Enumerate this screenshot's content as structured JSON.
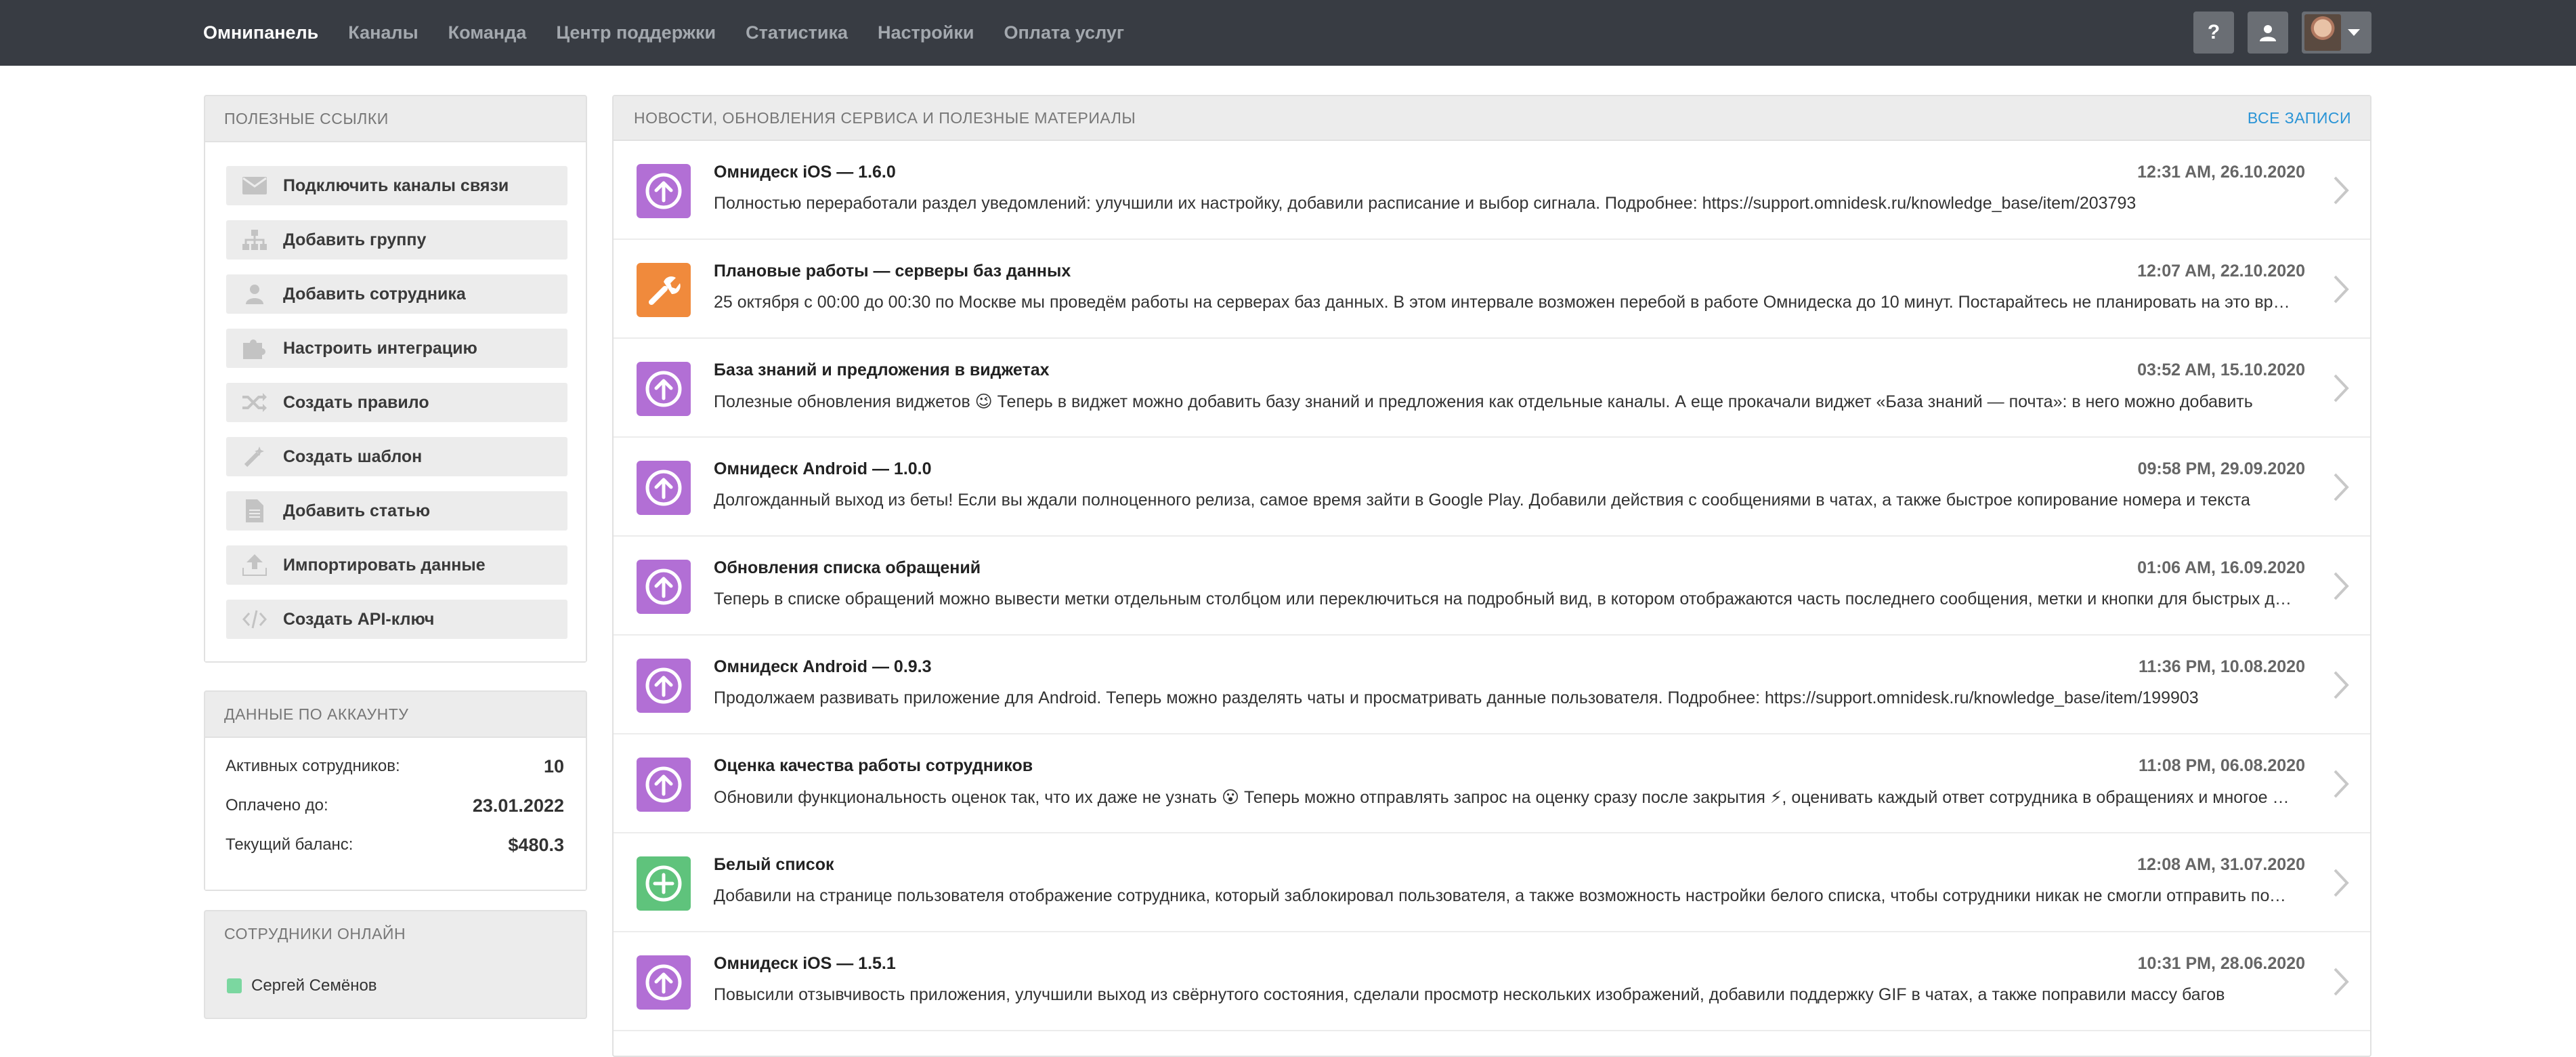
{
  "nav": {
    "items": [
      "Омнипанель",
      "Каналы",
      "Команда",
      "Центр поддержки",
      "Статистика",
      "Настройки",
      "Оплата услуг"
    ],
    "active_index": 0,
    "help_label": "?"
  },
  "links_panel": {
    "title": "ПОЛЕЗНЫЕ ССЫЛКИ",
    "items": [
      {
        "label": "Подключить каналы связи",
        "icon": "envelope-icon"
      },
      {
        "label": "Добавить группу",
        "icon": "sitemap-icon"
      },
      {
        "label": "Добавить сотрудника",
        "icon": "user-icon"
      },
      {
        "label": "Настроить интеграцию",
        "icon": "puzzle-icon"
      },
      {
        "label": "Создать правило",
        "icon": "shuffle-icon"
      },
      {
        "label": "Создать шаблон",
        "icon": "magic-wand-icon"
      },
      {
        "label": "Добавить статью",
        "icon": "document-icon"
      },
      {
        "label": "Импортировать данные",
        "icon": "upload-icon"
      },
      {
        "label": "Создать API-ключ",
        "icon": "code-icon"
      }
    ]
  },
  "account": {
    "title": "ДАННЫЕ ПО АККАУНТУ",
    "rows": [
      {
        "label": "Активных сотрудников:",
        "value": "10"
      },
      {
        "label": "Оплачено до:",
        "value": "23.01.2022"
      },
      {
        "label": "Текущий баланс:",
        "value": "$480.3"
      }
    ]
  },
  "online": {
    "title": "СОТРУДНИКИ ОНЛАЙН",
    "users": [
      {
        "name": "Сергей Семёнов",
        "status_color": "#7bd7a0"
      }
    ]
  },
  "news": {
    "title": "НОВОСТИ, ОБНОВЛЕНИЯ СЕРВИСА И ПОЛЕЗНЫЕ МАТЕРИАЛЫ",
    "all_label": "ВСЕ ЗАПИСИ",
    "items": [
      {
        "title": "Омнидеск iOS — 1.6.0",
        "date": "12:31 AM, 26.10.2020",
        "text": "Полностью переработали раздел уведомлений: улучшили их настройку, добавили расписание и выбор сигнала. Подробнее: https://support.omnidesk.ru/knowledge_base/item/203793",
        "icon": "arrow-up-icon",
        "color": "#b26fd5"
      },
      {
        "title": "Плановые работы — серверы баз данных",
        "date": "12:07 AM, 22.10.2020",
        "text": "25 октября с 00:00 до 00:30 по Москве мы проведём работы на серверах баз данных. В этом интервале возможен перебой в работе Омнидеска до 10 минут. Постарайтесь не планировать на это время важные дела",
        "icon": "wrench-icon",
        "color": "#f08a3c"
      },
      {
        "title": "База знаний и предложения в виджетах",
        "date": "03:52 AM, 15.10.2020",
        "text": "Полезные обновления виджетов 😉 Теперь в виджет можно добавить базу знаний и предложения как отдельные каналы. А еще прокачали виджет «База знаний — почта»:  в него можно добавить",
        "icon": "arrow-up-icon",
        "color": "#b26fd5"
      },
      {
        "title": "Омнидеск Android — 1.0.0",
        "date": "09:58 PM, 29.09.2020",
        "text": "Долгожданный выход из беты! Если вы ждали полноценного релиза, самое время зайти в Google Play. Добавили действия с сообщениями в чатах, а также быстрое копирование номера и текста",
        "icon": "arrow-up-icon",
        "color": "#b26fd5"
      },
      {
        "title": "Обновления списка обращений",
        "date": "01:06 AM, 16.09.2020",
        "text": "Теперь в списке обращений можно вывести метки отдельным столбцом или переключиться на подробный вид, в котором отображаются часть последнего сообщения, метки и кнопки для быстрых действий",
        "icon": "arrow-up-icon",
        "color": "#b26fd5"
      },
      {
        "title": "Омнидеск Android — 0.9.3",
        "date": "11:36 PM, 10.08.2020",
        "text": "Продолжаем развивать приложение для Android. Теперь можно разделять чаты и просматривать данные пользователя. Подробнее: https://support.omnidesk.ru/knowledge_base/item/199903",
        "icon": "arrow-up-icon",
        "color": "#b26fd5"
      },
      {
        "title": "Оценка качества работы сотрудников",
        "date": "11:08 PM, 06.08.2020",
        "text": "Обновили функциональность оценок так, что их даже не узнать 😮 Теперь можно отправлять запрос на оценку сразу после закрытия ⚡, оценивать каждый ответ сотрудника в обращениях и многое другое",
        "icon": "arrow-up-icon",
        "color": "#b26fd5"
      },
      {
        "title": "Белый список",
        "date": "12:08 AM, 31.07.2020",
        "text": "Добавили на странице пользователя отображение сотрудника, который заблокировал пользователя, а также возможность настройки белого списка, чтобы сотрудники никак не смогли отправить пользователя в спам",
        "icon": "plus-icon",
        "color": "#5fc37c"
      },
      {
        "title": "Омнидеск iOS — 1.5.1",
        "date": "10:31 PM, 28.06.2020",
        "text": "Повысили отзывчивость приложения, улучшили выход из свёрнутого состояния, сделали просмотр нескольких изображений, добавили поддержку GIF в чатах, а также поправили массу багов",
        "icon": "arrow-up-icon",
        "color": "#b26fd5"
      }
    ]
  }
}
